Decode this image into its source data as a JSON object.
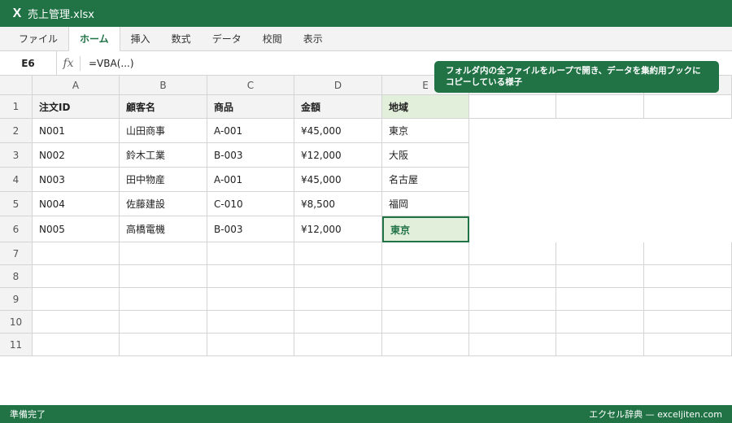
{
  "window": {
    "title": "売上管理.xlsx",
    "logo": "X"
  },
  "ribbon": {
    "tabs": [
      "ファイル",
      "ホーム",
      "挿入",
      "数式",
      "データ",
      "校閲",
      "表示"
    ],
    "active_tab": "ホーム"
  },
  "formula_bar": {
    "name_box": "E6",
    "fx_label": "fx",
    "formula": "=VBA(...)"
  },
  "tooltip": {
    "text": "フォルダ内の全ファイルをループで開き、データを集約用ブックにコピーしている様子"
  },
  "sheet": {
    "columns": [
      "A",
      "B",
      "C",
      "D",
      "E",
      "",
      "",
      ""
    ],
    "row_numbers": [
      "1",
      "2",
      "3",
      "4",
      "5",
      "6",
      "7",
      "8",
      "9",
      "10",
      "11"
    ],
    "header": [
      "注文ID",
      "顧客名",
      "商品",
      "金額",
      "地域"
    ],
    "rows": [
      [
        "N001",
        "山田商事",
        "A-001",
        "¥45,000",
        "東京"
      ],
      [
        "N002",
        "鈴木工業",
        "B-003",
        "¥12,000",
        "大阪"
      ],
      [
        "N003",
        "田中物産",
        "A-001",
        "¥45,000",
        "名古屋"
      ],
      [
        "N004",
        "佐藤建設",
        "C-010",
        "¥8,500",
        "福岡"
      ],
      [
        "N005",
        "高橋電機",
        "B-003",
        "¥12,000",
        "東京"
      ]
    ],
    "selected_cell": "E6"
  },
  "status_bar": {
    "left": "準備完了",
    "right": "エクセル辞典 — exceljiten.com"
  },
  "colors": {
    "accent": "#217346",
    "header_fill": "#f3f3f3",
    "highlight_fill": "#e2efda",
    "gridline": "#d4d4d4"
  }
}
